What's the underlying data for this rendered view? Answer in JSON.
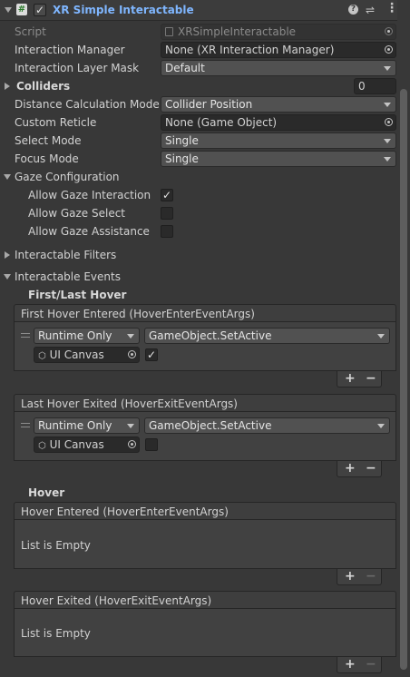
{
  "header": {
    "title": "XR Simple Interactable",
    "enabled": true,
    "icons": [
      "fold-triangle-icon",
      "script-icon",
      "help-icon",
      "preset-icon",
      "more-icon"
    ]
  },
  "props": {
    "script_label": "Script",
    "script_value": "XRSimpleInteractable",
    "im_label": "Interaction Manager",
    "im_value": "None (XR Interaction Manager)",
    "ilm_label": "Interaction Layer Mask",
    "ilm_value": "Default",
    "colliders_label": "Colliders",
    "colliders_value": "0",
    "dcm_label": "Distance Calculation Mode",
    "dcm_value": "Collider Position",
    "cr_label": "Custom Reticle",
    "cr_value": "None (Game Object)",
    "sm_label": "Select Mode",
    "sm_value": "Single",
    "fm_label": "Focus Mode",
    "fm_value": "Single"
  },
  "gaze": {
    "label": "Gaze Configuration",
    "allow_interaction_label": "Allow Gaze Interaction",
    "allow_interaction": true,
    "allow_select_label": "Allow Gaze Select",
    "allow_select": false,
    "allow_assistance_label": "Allow Gaze Assistance",
    "allow_assistance": false
  },
  "filters_label": "Interactable Filters",
  "events_label": "Interactable Events",
  "first_last_hover": "First/Last Hover",
  "hover": "Hover",
  "events": [
    {
      "title": "First Hover Entered (HoverEnterEventArgs)",
      "runtime": "Runtime Only",
      "function": "GameObject.SetActive",
      "object": "UI Canvas",
      "checked": true
    },
    {
      "title": "Last Hover Exited (HoverExitEventArgs)",
      "runtime": "Runtime Only",
      "function": "GameObject.SetActive",
      "object": "UI Canvas",
      "checked": false
    }
  ],
  "empty_events": [
    {
      "title": "Hover Entered (HoverEnterEventArgs)",
      "empty_text": "List is Empty"
    },
    {
      "title": "Hover Exited (HoverExitEventArgs)",
      "empty_text": "List is Empty"
    }
  ],
  "add_label": "+",
  "remove_label": "−"
}
